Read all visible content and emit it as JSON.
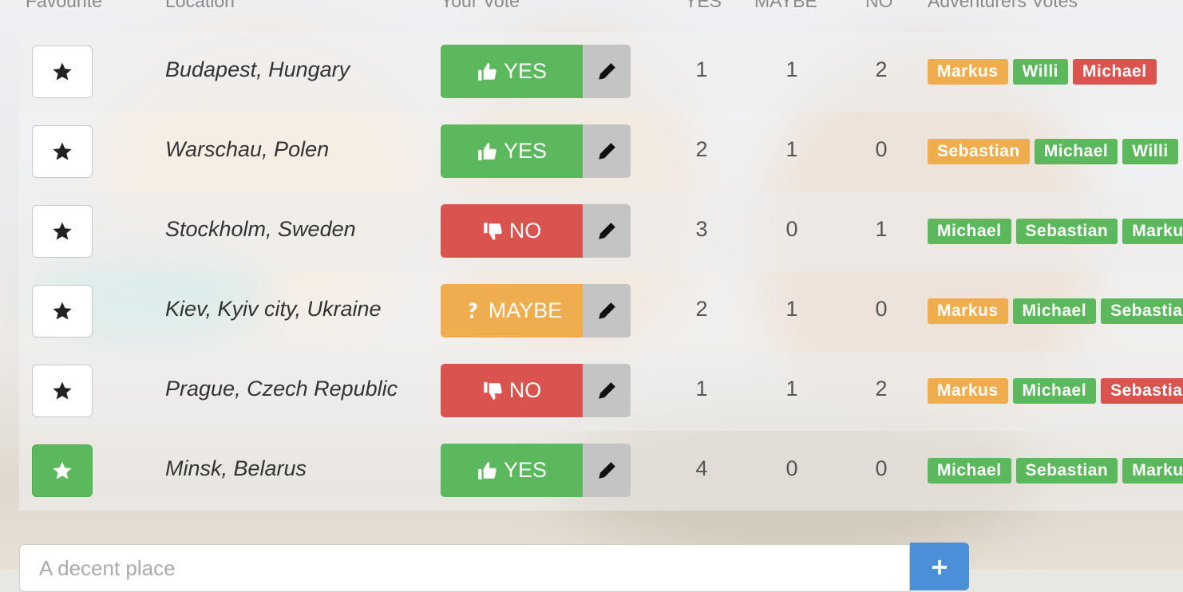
{
  "header": {
    "favourite": "Favourite",
    "location": "Location",
    "your_vote": "Your Vote",
    "yes": "YES",
    "maybe": "MAYBE",
    "no": "NO",
    "adventurers_votes": "Adventurers Votes"
  },
  "rows": [
    {
      "location": "Budapest, Hungary",
      "favourite": false,
      "vote": "yes",
      "vote_label": "YES",
      "yes": 1,
      "maybe": 1,
      "no": 2,
      "votes": [
        {
          "name": "Markus",
          "vote": "maybe"
        },
        {
          "name": "Willi",
          "vote": "yes"
        },
        {
          "name": "Michael",
          "vote": "no"
        }
      ]
    },
    {
      "location": "Warschau, Polen",
      "favourite": false,
      "vote": "yes",
      "vote_label": "YES",
      "yes": 2,
      "maybe": 1,
      "no": 0,
      "votes": [
        {
          "name": "Sebastian",
          "vote": "maybe"
        },
        {
          "name": "Michael",
          "vote": "yes"
        },
        {
          "name": "Willi",
          "vote": "yes"
        }
      ]
    },
    {
      "location": "Stockholm, Sweden",
      "favourite": false,
      "vote": "no",
      "vote_label": "NO",
      "yes": 3,
      "maybe": 0,
      "no": 1,
      "votes": [
        {
          "name": "Michael",
          "vote": "yes"
        },
        {
          "name": "Sebastian",
          "vote": "yes"
        },
        {
          "name": "Markus",
          "vote": "yes"
        }
      ]
    },
    {
      "location": "Kiev, Kyiv city, Ukraine",
      "favourite": false,
      "vote": "maybe",
      "vote_label": "MAYBE",
      "yes": 2,
      "maybe": 1,
      "no": 0,
      "votes": [
        {
          "name": "Markus",
          "vote": "maybe"
        },
        {
          "name": "Michael",
          "vote": "yes"
        },
        {
          "name": "Sebastian",
          "vote": "yes"
        }
      ]
    },
    {
      "location": "Prague, Czech Republic",
      "favourite": false,
      "vote": "no",
      "vote_label": "NO",
      "yes": 1,
      "maybe": 1,
      "no": 2,
      "votes": [
        {
          "name": "Markus",
          "vote": "maybe"
        },
        {
          "name": "Michael",
          "vote": "yes"
        },
        {
          "name": "Sebastian",
          "vote": "no"
        }
      ]
    },
    {
      "location": "Minsk, Belarus",
      "favourite": true,
      "vote": "yes",
      "vote_label": "YES",
      "yes": 4,
      "maybe": 0,
      "no": 0,
      "votes": [
        {
          "name": "Michael",
          "vote": "yes"
        },
        {
          "name": "Sebastian",
          "vote": "yes"
        },
        {
          "name": "Markus",
          "vote": "yes"
        }
      ]
    }
  ],
  "add": {
    "placeholder": "A decent place"
  },
  "colors": {
    "yes": "#5cb85c",
    "no": "#d9534f",
    "maybe": "#f0ad4e",
    "add_button": "#4a90d9"
  },
  "icons": {
    "favourite": "star-icon",
    "yes": "thumbs-up-icon",
    "no": "thumbs-down-icon",
    "maybe": "question-icon",
    "edit": "pencil-icon",
    "add": "plus-icon"
  }
}
